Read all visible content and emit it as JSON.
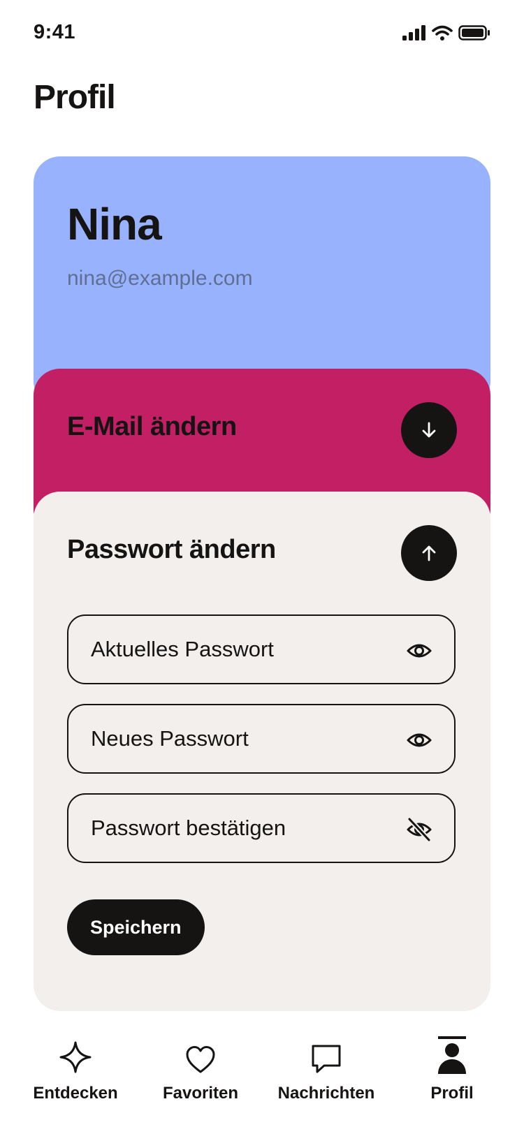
{
  "status_bar": {
    "time": "9:41"
  },
  "page": {
    "title": "Profil"
  },
  "profile": {
    "name": "Nina",
    "email": "nina@example.com"
  },
  "email_section": {
    "title": "E-Mail ändern",
    "toggle_icon": "arrow-down-icon",
    "expanded": false
  },
  "password_section": {
    "title": "Passwort ändern",
    "toggle_icon": "arrow-up-icon",
    "expanded": true,
    "fields": [
      {
        "placeholder": "Aktuelles Passwort",
        "value": "",
        "visibility_icon": "eye-icon"
      },
      {
        "placeholder": "Neues Passwort",
        "value": "",
        "visibility_icon": "eye-icon"
      },
      {
        "placeholder": "Passwort bestätigen",
        "value": "",
        "visibility_icon": "eye-off-icon"
      }
    ],
    "save_label": "Speichern"
  },
  "tabbar": {
    "items": [
      {
        "label": "Entdecken",
        "icon": "sparkle-icon",
        "active": false
      },
      {
        "label": "Favoriten",
        "icon": "heart-icon",
        "active": false
      },
      {
        "label": "Nachrichten",
        "icon": "chat-bubble-icon",
        "active": false
      },
      {
        "label": "Profil",
        "icon": "person-icon",
        "active": true
      }
    ]
  },
  "colors": {
    "profile_card": "#98b2fd",
    "email_card": "#c21f64",
    "password_card": "#f2efed",
    "primary_dark": "#151412"
  }
}
